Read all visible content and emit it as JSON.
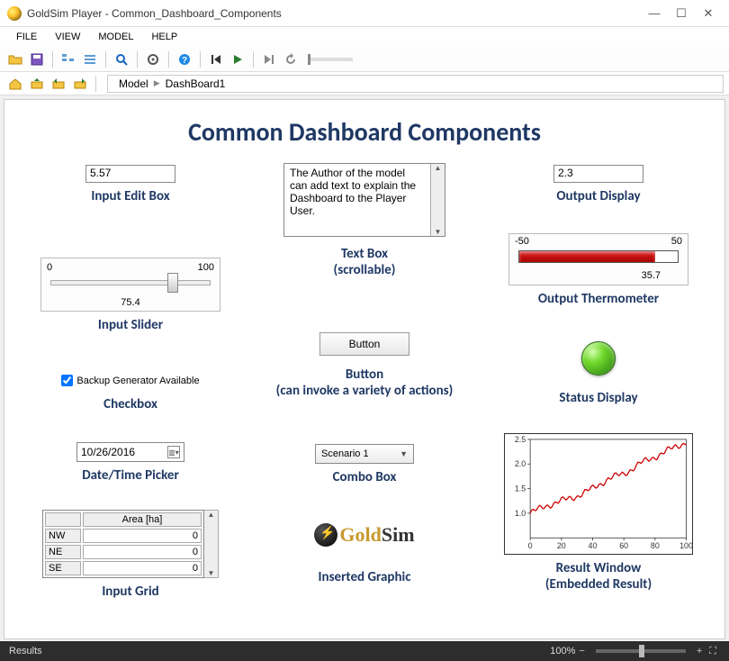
{
  "window": {
    "title": "GoldSim Player - Common_Dashboard_Components"
  },
  "menus": {
    "file": "FILE",
    "view": "VIEW",
    "model": "MODEL",
    "help": "HELP"
  },
  "breadcrumb": {
    "root": "Model",
    "page": "DashBoard1"
  },
  "dashboard": {
    "title": "Common Dashboard Components",
    "input_edit": {
      "value": "5.57",
      "label": "Input Edit Box"
    },
    "slider": {
      "min": "0",
      "max": "100",
      "value": "75.4",
      "label": "Input Slider"
    },
    "checkbox": {
      "text": "Backup Generator Available",
      "checked": true,
      "label": "Checkbox"
    },
    "datepicker": {
      "value": "10/26/2016",
      "label": "Date/Time Picker"
    },
    "grid": {
      "label": "Input Grid",
      "col_header": "Area [ha]",
      "rows": [
        {
          "name": "NW",
          "value": "0"
        },
        {
          "name": "NE",
          "value": "0"
        },
        {
          "name": "SE",
          "value": "0"
        }
      ]
    },
    "textbox": {
      "content": "The Author of the model can add text to explain the Dashboard to the Player User.",
      "label_line1": "Text Box",
      "label_line2": "(scrollable)"
    },
    "button": {
      "text": "Button",
      "label_line1": "Button",
      "label_line2": "(can invoke a variety of actions)"
    },
    "combo": {
      "value": "Scenario 1",
      "label": "Combo Box"
    },
    "inserted_graphic": {
      "label": "Inserted Graphic",
      "brand1": "Gold",
      "brand2": "Sim"
    },
    "out_display": {
      "value": "2.3",
      "label": "Output Display"
    },
    "thermometer": {
      "min": "-50",
      "max": "50",
      "value": "35.7",
      "label": "Output Thermometer"
    },
    "status": {
      "label": "Status Display"
    },
    "result": {
      "label_line1": "Result Window",
      "label_line2": "(Embedded Result)"
    }
  },
  "chart_data": {
    "type": "line",
    "x": [
      0,
      10,
      20,
      30,
      40,
      50,
      60,
      70,
      80,
      90,
      100
    ],
    "values": [
      1.0,
      1.15,
      1.25,
      1.35,
      1.5,
      1.7,
      1.8,
      2.0,
      2.15,
      2.3,
      2.45
    ],
    "xlim": [
      0,
      100
    ],
    "ylim": [
      0.5,
      2.5
    ],
    "xticks": [
      "0",
      "20",
      "40",
      "60",
      "80",
      "100"
    ],
    "yticks": [
      "1.0",
      "1.5",
      "2.0",
      "2.5"
    ],
    "title": "",
    "xlabel": "",
    "ylabel": ""
  },
  "statusbar": {
    "left": "Results",
    "zoom": "100%"
  }
}
